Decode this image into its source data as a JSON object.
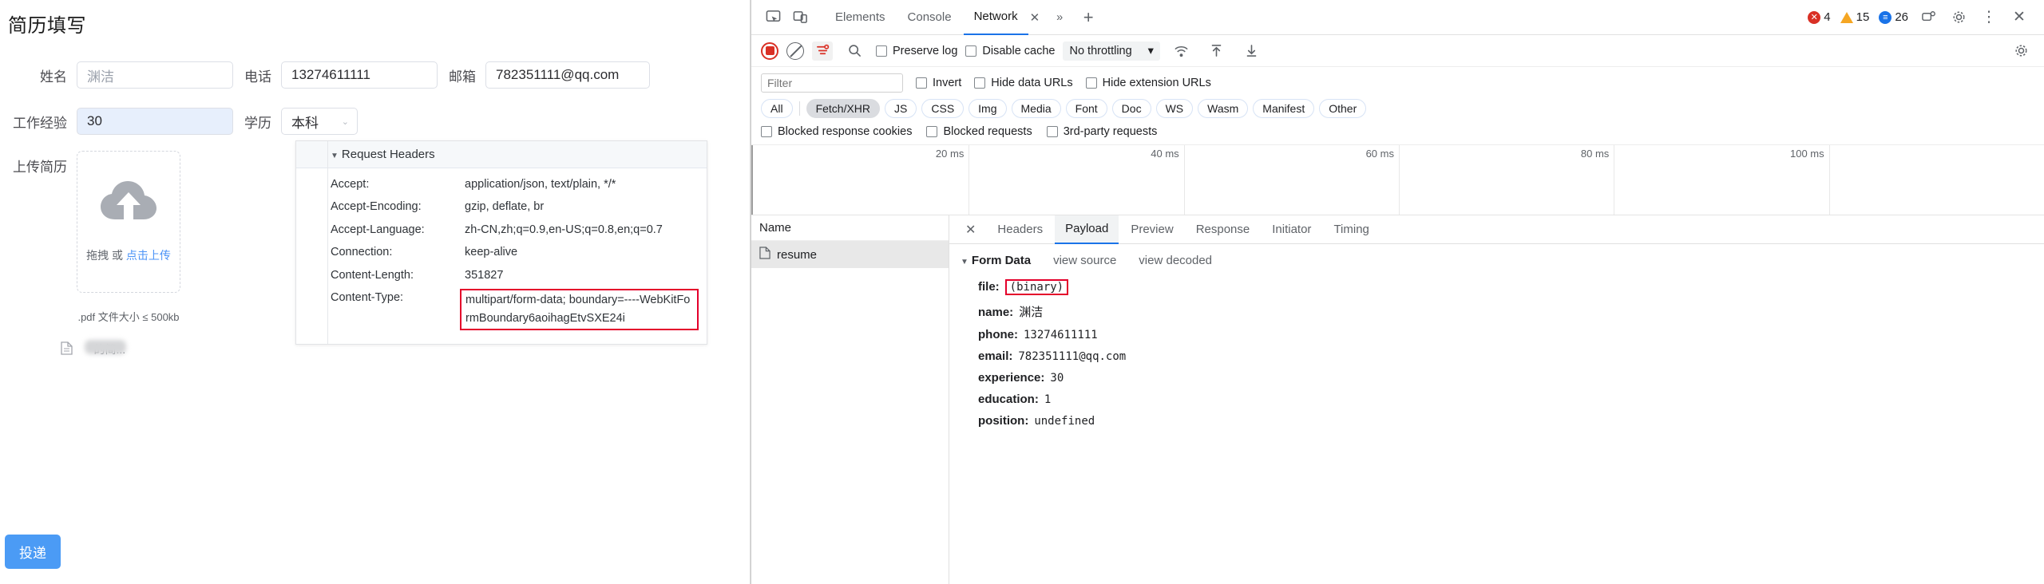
{
  "page": {
    "title": "简历填写",
    "fields": {
      "name_label": "姓名",
      "name_placeholder": "渊洁",
      "phone_label": "电话",
      "phone_value": "13274611111",
      "email_label": "邮箱",
      "email_value": "782351111@qq.com",
      "experience_label": "工作经验",
      "experience_value": "30",
      "education_label": "学历",
      "education_value": "本科",
      "upload_label": "上传简历"
    },
    "upload": {
      "drop_text": "拖拽 或 ",
      "drop_link": "点击上传",
      "hint": ".pdf 文件大小 ≤ 500kb",
      "file_item": "的简...",
      "icon": "cloud-upload-icon"
    },
    "submit_label": "投递",
    "accent": "#4b9bf5"
  },
  "request_headers": {
    "section_title": "Request Headers",
    "rows": [
      {
        "key": "Accept:",
        "value": "application/json, text/plain, */*"
      },
      {
        "key": "Accept-Encoding:",
        "value": "gzip, deflate, br"
      },
      {
        "key": "Accept-Language:",
        "value": "zh-CN,zh;q=0.9,en-US;q=0.8,en;q=0.7"
      },
      {
        "key": "Connection:",
        "value": "keep-alive"
      },
      {
        "key": "Content-Length:",
        "value": "351827"
      }
    ],
    "content_type_key": "Content-Type:",
    "content_type_value": "multipart/form-data; boundary=----WebKitFormBoundary6aoihagEtvSXE24i",
    "highlight_color": "#e4002b"
  },
  "devtools": {
    "tabs": [
      {
        "label": "Elements",
        "active": false
      },
      {
        "label": "Console",
        "active": false
      },
      {
        "label": "Network",
        "active": true
      }
    ],
    "tab_close": "✕",
    "more_tabs": "»",
    "add_tab": "+",
    "counters": {
      "errors": "4",
      "warnings": "15",
      "messages": "26"
    },
    "icons": {
      "inspect": "inspect-element-icon",
      "device": "device-toolbar-icon",
      "console_drawer": "console-drawer-icon",
      "settings": "gear-icon",
      "more": "kebab-menu-icon",
      "close": "close-icon"
    },
    "toolbar": {
      "record": "record-button",
      "clear": "clear-button",
      "filter_toggle": "filter-icon",
      "search": "search-icon",
      "preserve_log": "Preserve log",
      "disable_cache": "Disable cache",
      "throttling": "No throttling",
      "throttle_caret": "▾",
      "wifi": "network-conditions-icon",
      "import": "import-har-icon",
      "export": "export-har-icon",
      "settings": "gear-icon"
    },
    "filters": {
      "filter_placeholder": "Filter",
      "invert": "Invert",
      "hide_data_urls": "Hide data URLs",
      "hide_extension_urls": "Hide extension URLs",
      "types": [
        "All",
        "Fetch/XHR",
        "JS",
        "CSS",
        "Img",
        "Media",
        "Font",
        "Doc",
        "WS",
        "Wasm",
        "Manifest",
        "Other"
      ],
      "active_type": "Fetch/XHR",
      "blocked_response_cookies": "Blocked response cookies",
      "blocked_requests": "Blocked requests",
      "third_party_requests": "3rd-party requests"
    },
    "timeline_ticks": [
      "20 ms",
      "40 ms",
      "60 ms",
      "80 ms",
      "100 ms"
    ],
    "request_list": {
      "column_header": "Name",
      "items": [
        {
          "name": "resume",
          "icon": "document-icon"
        }
      ]
    },
    "detail": {
      "close": "✕",
      "tabs": [
        {
          "label": "Headers",
          "active": false
        },
        {
          "label": "Payload",
          "active": true
        },
        {
          "label": "Preview",
          "active": false
        },
        {
          "label": "Response",
          "active": false
        },
        {
          "label": "Initiator",
          "active": false
        },
        {
          "label": "Timing",
          "active": false
        }
      ],
      "form_data": {
        "title": "Form Data",
        "view_source": "view source",
        "view_decoded": "view decoded",
        "rows": [
          {
            "key": "file:",
            "value": "(binary)",
            "boxed": true
          },
          {
            "key": "name:",
            "value": "渊洁",
            "cjk": true
          },
          {
            "key": "phone:",
            "value": "13274611111"
          },
          {
            "key": "email:",
            "value": "782351111@qq.com"
          },
          {
            "key": "experience:",
            "value": "30"
          },
          {
            "key": "education:",
            "value": "1"
          },
          {
            "key": "position:",
            "value": "undefined"
          }
        ]
      }
    }
  }
}
